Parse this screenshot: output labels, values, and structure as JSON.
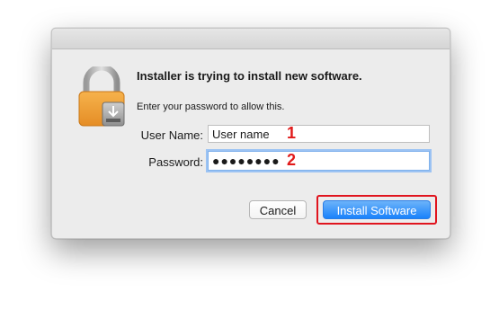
{
  "dialog": {
    "heading": "Installer is trying to install new software.",
    "subtext": "Enter your password to allow this."
  },
  "form": {
    "username_label": "User Name:",
    "username_value": "User name",
    "password_label": "Password:",
    "password_value": "●●●●●●●●"
  },
  "buttons": {
    "cancel_label": "Cancel",
    "install_label": "Install Software"
  },
  "annotations": {
    "marker_1": "1",
    "marker_2": "2",
    "highlight_color": "#e0141e"
  },
  "icons": {
    "lock": "lock-icon"
  },
  "colors": {
    "accent": "#1a82fb",
    "focus_ring": "#9cc3f3",
    "dialog_bg": "#ececec"
  }
}
